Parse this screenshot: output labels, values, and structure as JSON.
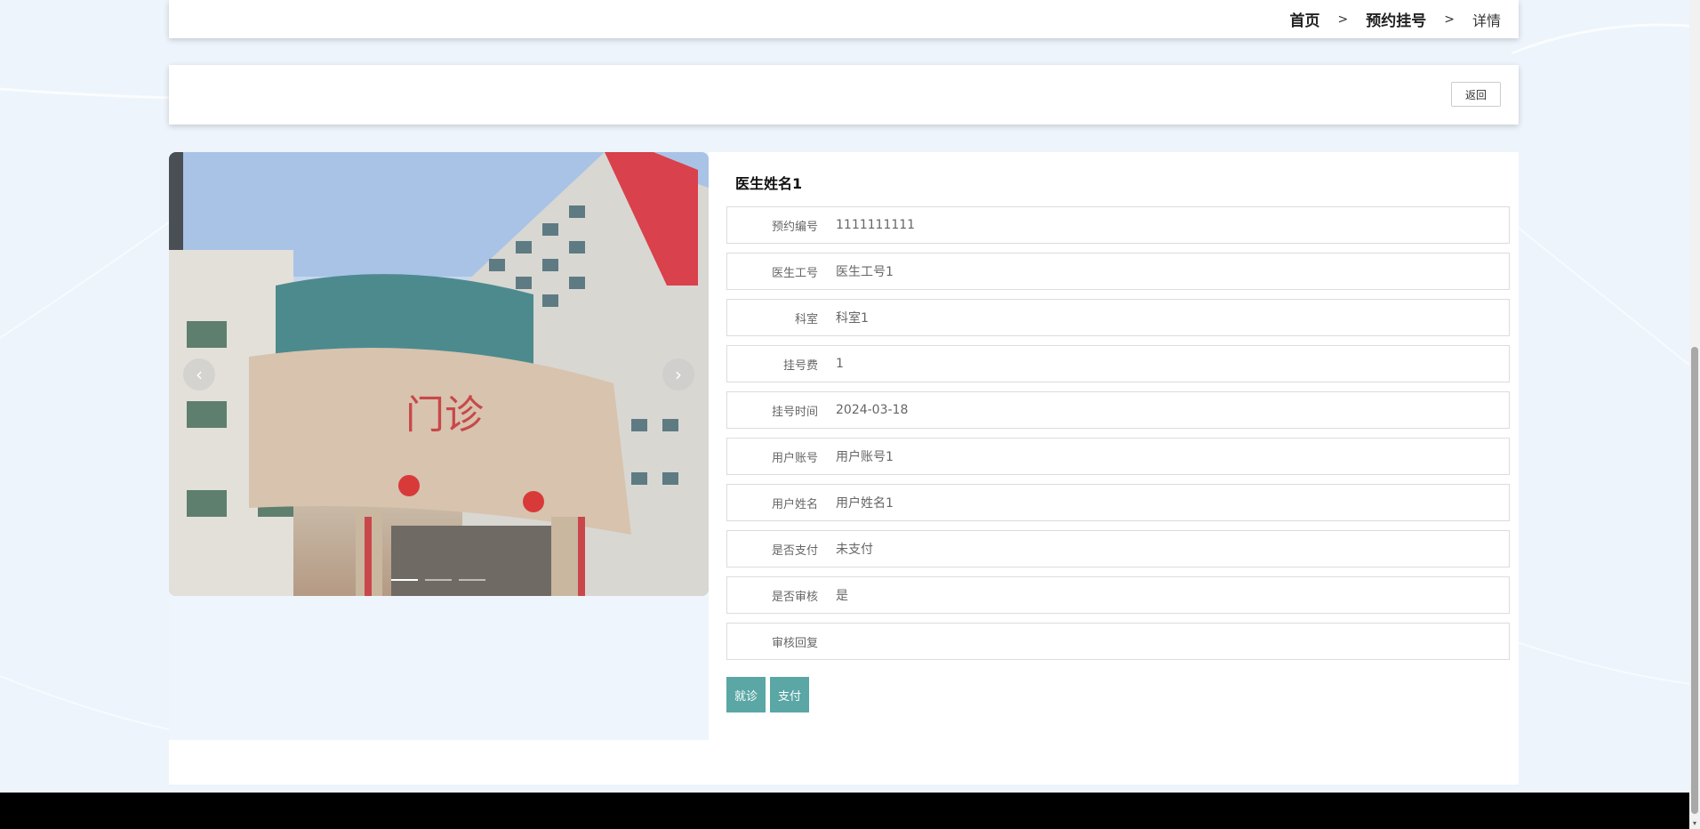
{
  "breadcrumb": {
    "home": "首页",
    "section": "预约挂号",
    "current": "详情",
    "separator": ">"
  },
  "actions": {
    "back_label": "返回"
  },
  "carousel": {
    "prev_icon": "chevron-left-icon",
    "next_icon": "chevron-right-icon",
    "slide_count": 3,
    "active_index": 0,
    "sign_text": "门诊"
  },
  "detail": {
    "doctor_name": "医生姓名1",
    "fields": [
      {
        "label": "预约编号",
        "value": "1111111111"
      },
      {
        "label": "医生工号",
        "value": "医生工号1"
      },
      {
        "label": "科室",
        "value": "科室1"
      },
      {
        "label": "挂号费",
        "value": "1"
      },
      {
        "label": "挂号时间",
        "value": "2024-03-18"
      },
      {
        "label": "用户账号",
        "value": "用户账号1"
      },
      {
        "label": "用户姓名",
        "value": "用户姓名1"
      },
      {
        "label": "是否支付",
        "value": "未支付"
      },
      {
        "label": "是否审核",
        "value": "是"
      },
      {
        "label": "审核回复",
        "value": ""
      }
    ],
    "visit_button": "就诊",
    "pay_button": "支付"
  },
  "colors": {
    "accent": "#5aa7a5",
    "footer": "#000000",
    "background": "#edf4fc"
  }
}
